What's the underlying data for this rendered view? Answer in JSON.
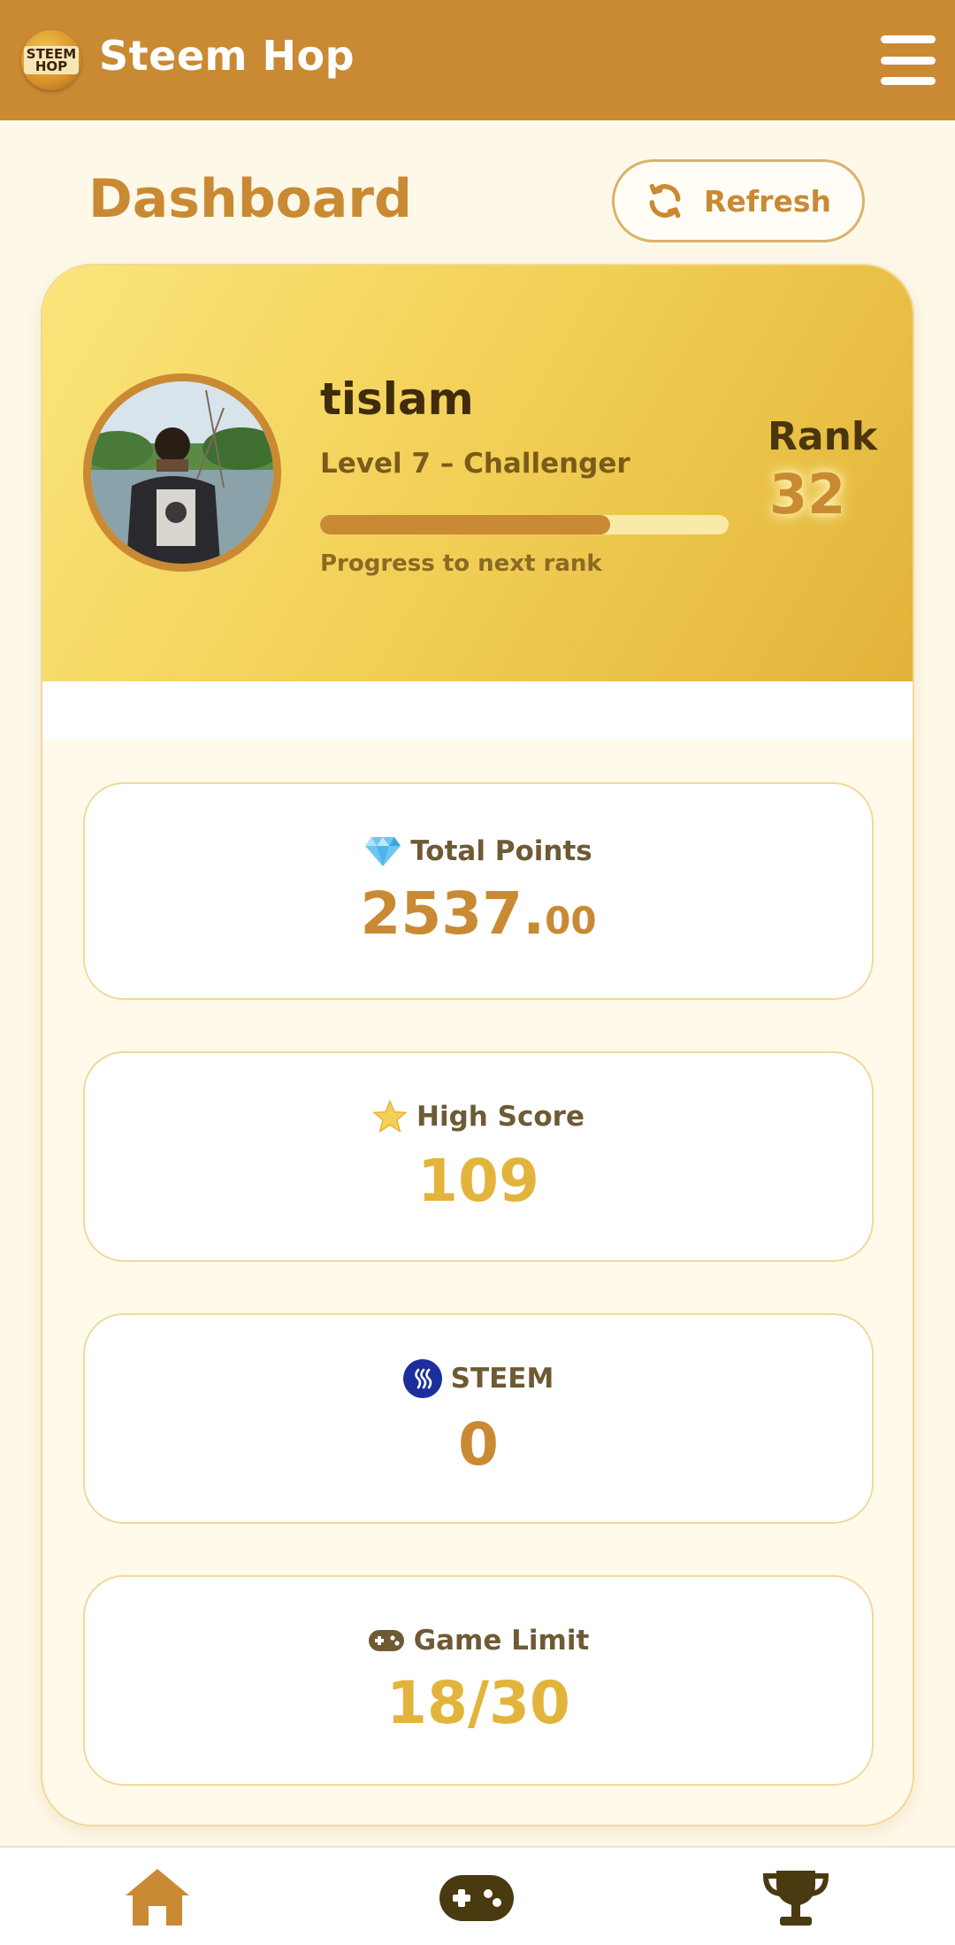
{
  "header": {
    "logo_text_top": "STEEM",
    "logo_text_bottom": "HOP",
    "app_title": "Steem Hop"
  },
  "page": {
    "title": "Dashboard",
    "refresh_label": "Refresh"
  },
  "profile": {
    "username": "tislam",
    "level": "Level 7 – Challenger",
    "progress_label": "Progress to next rank",
    "progress_fraction": 0.71,
    "rank_label": "Rank",
    "rank_value": "32"
  },
  "stats": [
    {
      "icon": "diamond-icon",
      "label": "Total Points",
      "value_main": "2537.",
      "value_decimal": "00"
    },
    {
      "icon": "star-icon",
      "label": "High Score",
      "value": "109"
    },
    {
      "icon": "steem-icon",
      "label": "STEEM",
      "value": "0"
    },
    {
      "icon": "gamepad-icon",
      "label": "Game Limit",
      "value": "18/30"
    }
  ],
  "nav": {
    "items": [
      "home-icon",
      "gamepad-icon",
      "trophy-icon"
    ]
  },
  "colors": {
    "header": "#c98a33",
    "accent": "#c98a33",
    "gold": "#e3b43c",
    "background": "#fdf8e8"
  }
}
